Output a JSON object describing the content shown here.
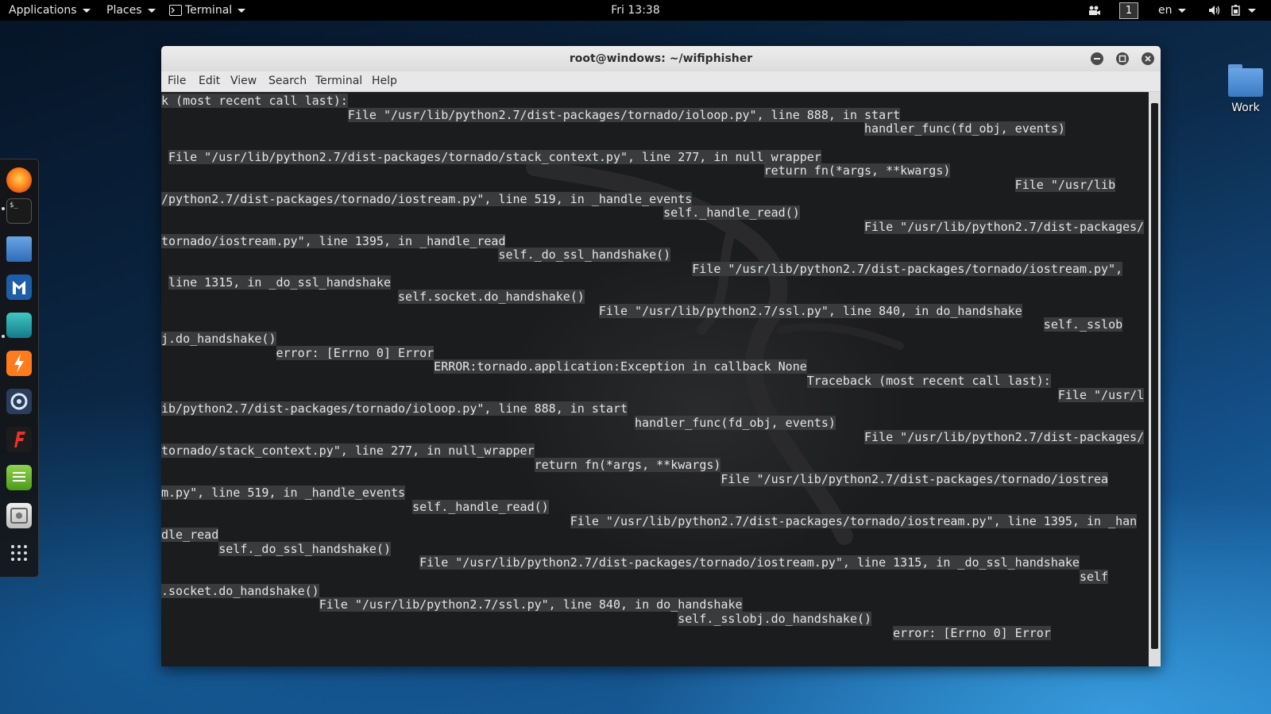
{
  "topbar": {
    "applications": "Applications",
    "places": "Places",
    "terminal": "Terminal",
    "clock": "Fri 13:38",
    "workspace": "1",
    "language": "en"
  },
  "window": {
    "title": "root@windows: ~/wifiphisher",
    "menu": [
      "File",
      "Edit",
      "View",
      "Search",
      "Terminal",
      "Help"
    ]
  },
  "terminal_lines": [
    "k (most recent call last):",
    "                          File \"/usr/lib/python2.7/dist-packages/tornado/ioloop.py\", line 888, in start",
    "                                                                                                  handler_func(fd_obj, events)",
    "",
    " File \"/usr/lib/python2.7/dist-packages/tornado/stack_context.py\", line 277, in null_wrapper",
    "                                                                                    return fn(*args, **kwargs)",
    "                                                                                                                       File \"/usr/lib",
    "/python2.7/dist-packages/tornado/iostream.py\", line 519, in _handle_events",
    "                                                                      self._handle_read()",
    "                                                                                                  File \"/usr/lib/python2.7/dist-packages/",
    "tornado/iostream.py\", line 1395, in _handle_read",
    "                                               self._do_ssl_handshake()",
    "                                                                          File \"/usr/lib/python2.7/dist-packages/tornado/iostream.py\",",
    " line 1315, in _do_ssl_handshake",
    "                                 self.socket.do_handshake()",
    "                                                             File \"/usr/lib/python2.7/ssl.py\", line 840, in do_handshake",
    "                                                                                                                           self._sslob",
    "j.do_handshake()",
    "                error: [Errno 0] Error",
    "                                      ERROR:tornado.application:Exception in callback None",
    "                                                                                          Traceback (most recent call last):",
    "                                                                                                                             File \"/usr/l",
    "ib/python2.7/dist-packages/tornado/ioloop.py\", line 888, in start",
    "                                                                  handler_func(fd_obj, events)",
    "                                                                                                  File \"/usr/lib/python2.7/dist-packages/",
    "tornado/stack_context.py\", line 277, in null_wrapper",
    "                                                    return fn(*args, **kwargs)",
    "                                                                              File \"/usr/lib/python2.7/dist-packages/tornado/iostrea",
    "m.py\", line 519, in _handle_events",
    "                                   self._handle_read()",
    "                                                         File \"/usr/lib/python2.7/dist-packages/tornado/iostream.py\", line 1395, in _han",
    "dle_read",
    "        self._do_ssl_handshake()",
    "                                    File \"/usr/lib/python2.7/dist-packages/tornado/iostream.py\", line 1315, in _do_ssl_handshake",
    "                                                                                                                                self",
    ".socket.do_handshake()",
    "                      File \"/usr/lib/python2.7/ssl.py\", line 840, in do_handshake",
    "                                                                        self._sslobj.do_handshake()",
    "                                                                                                      error: [Errno 0] Error"
  ],
  "desktop": {
    "work_folder_label": "Work"
  },
  "dock": {
    "items": [
      "firefox-icon",
      "terminal-icon",
      "files-icon",
      "metasploit-icon",
      "armitage-icon",
      "burpsuite-icon",
      "maltego-icon",
      "faraday-icon",
      "leafpad-icon",
      "screenshot-icon",
      "show-apps-icon"
    ]
  },
  "colors": {
    "terminal_bg": "#1b1c1e",
    "terminal_fg": "#e4e4e4",
    "highlight": "#3a3b3c",
    "topbar_bg": "#000000"
  }
}
